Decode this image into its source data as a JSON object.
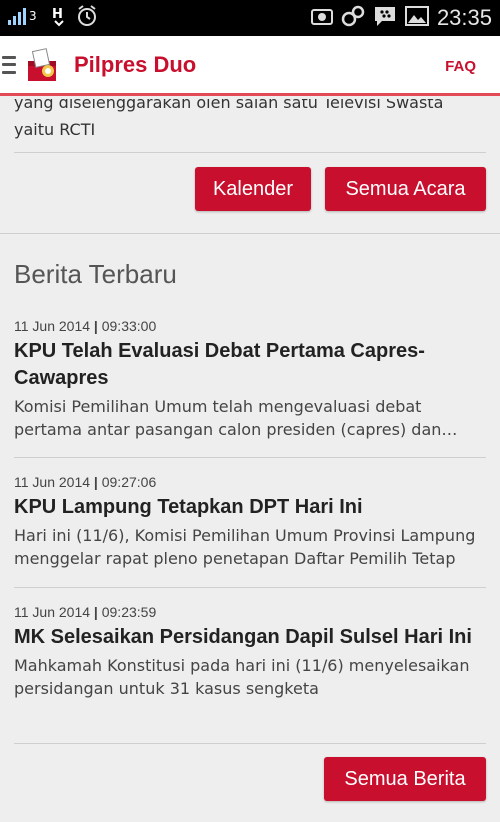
{
  "status_bar": {
    "time": "23:35",
    "left_icons": [
      "signal-3g-icon",
      "h-icon",
      "alarm-icon"
    ],
    "right_icons": [
      "screenshot-icon",
      "link-icon",
      "bbm-icon",
      "image-icon"
    ]
  },
  "app_bar": {
    "title": "Pilpres Duo",
    "faq_label": "FAQ",
    "accent_color": "#c8102e"
  },
  "event_section": {
    "partial_description": "yang diselenggarakan oleh salah satu Televisi Swasta yaitu RCTI",
    "calendar_button": "Kalender",
    "all_events_button": "Semua Acara"
  },
  "news_section": {
    "title": "Berita Terbaru",
    "items": [
      {
        "date": "11 Jun 2014",
        "time": "09:33:00",
        "title": "KPU Telah Evaluasi Debat Pertama Capres-Cawapres",
        "excerpt": "Komisi Pemilihan Umum telah mengevaluasi debat pertama antar pasangan calon presiden (capres) dan calon wakil presiden"
      },
      {
        "date": "11 Jun 2014",
        "time": "09:27:06",
        "title": "KPU Lampung Tetapkan DPT Hari Ini",
        "excerpt": "Hari ini (11/6), Komisi Pemilihan Umum Provinsi Lampung menggelar rapat pleno penetapan Daftar Pemilih Tetap"
      },
      {
        "date": "11 Jun 2014",
        "time": "09:23:59",
        "title": "MK Selesaikan Persidangan Dapil Sulsel Hari Ini",
        "excerpt": "Mahkamah Konstitusi pada hari ini (11/6) menyelesaikan persidangan untuk 31 kasus sengketa"
      }
    ],
    "all_news_button": "Semua Berita"
  }
}
